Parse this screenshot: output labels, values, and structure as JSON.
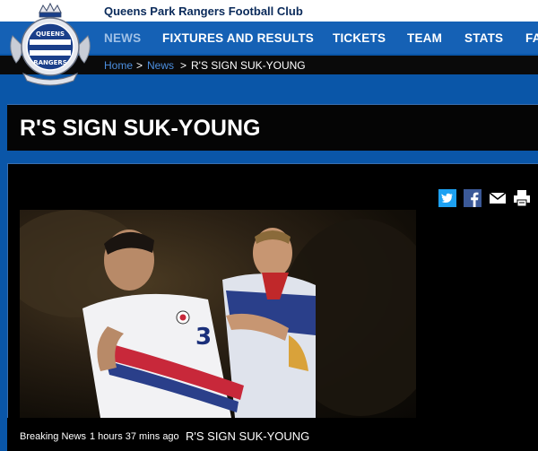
{
  "header": {
    "club_name": "Queens Park Rangers Football Club",
    "logo_text_top": "QUEENS",
    "logo_text_mid": "PARK",
    "logo_text_bottom": "RANGERS"
  },
  "nav": {
    "items": [
      {
        "label": "NEWS",
        "active": true
      },
      {
        "label": "FIXTURES AND RESULTS",
        "active": false
      },
      {
        "label": "TICKETS",
        "active": false
      },
      {
        "label": "TEAM",
        "active": false
      },
      {
        "label": "STATS",
        "active": false
      },
      {
        "label": "FA",
        "active": false
      }
    ]
  },
  "breadcrumb": {
    "home": "Home",
    "sep1": ">",
    "news": "News",
    "sep2": ">",
    "current": "R'S SIGN SUK-YOUNG"
  },
  "article": {
    "title": "R'S SIGN SUK-YOUNG"
  },
  "share": {
    "icons": [
      "twitter-icon",
      "facebook-icon",
      "email-icon",
      "print-icon"
    ]
  },
  "photo": {
    "jersey_number": "3"
  },
  "caption": {
    "label": "Breaking News",
    "time": "1 hours 37 mins ago",
    "headline": "R'S SIGN SUK-YOUNG"
  },
  "colors": {
    "page_blue": "#0a56a8",
    "nav_blue": "#1561b5",
    "link_blue": "#4c8fe0",
    "twitter": "#1da1f2",
    "facebook": "#3b5998"
  }
}
